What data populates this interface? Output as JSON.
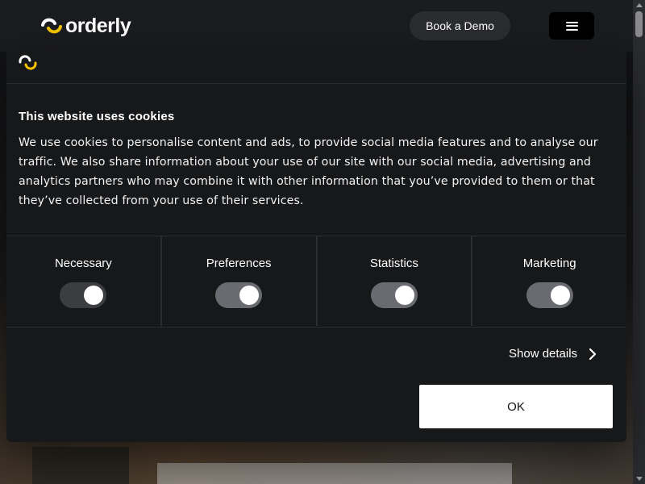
{
  "header": {
    "logo_text": "orderly",
    "logo_icon": "orderly-logo-icon",
    "demo_label": "Book a Demo",
    "menu_icon": "hamburger-menu-icon"
  },
  "cookie": {
    "brand_icon": "orderly-mark-icon",
    "title": "This website uses cookies",
    "body": "We use cookies to personalise content and ads, to provide social media features and to analyse our traffic. We also share information about your use of our site with our social media, advertising and analytics partners who may combine it with other information that you’ve provided to them or that they’ve collected from your use of their services.",
    "toggles": [
      {
        "label": "Necessary",
        "checked": true,
        "disabled": true
      },
      {
        "label": "Preferences",
        "checked": true,
        "disabled": false
      },
      {
        "label": "Statistics",
        "checked": true,
        "disabled": false
      },
      {
        "label": "Marketing",
        "checked": true,
        "disabled": false
      }
    ],
    "show_details_label": "Show details",
    "ok_label": "OK"
  },
  "colors": {
    "accent_yellow": "#f5c400",
    "background": "#1b1c1f",
    "dialog": "#17181a"
  }
}
